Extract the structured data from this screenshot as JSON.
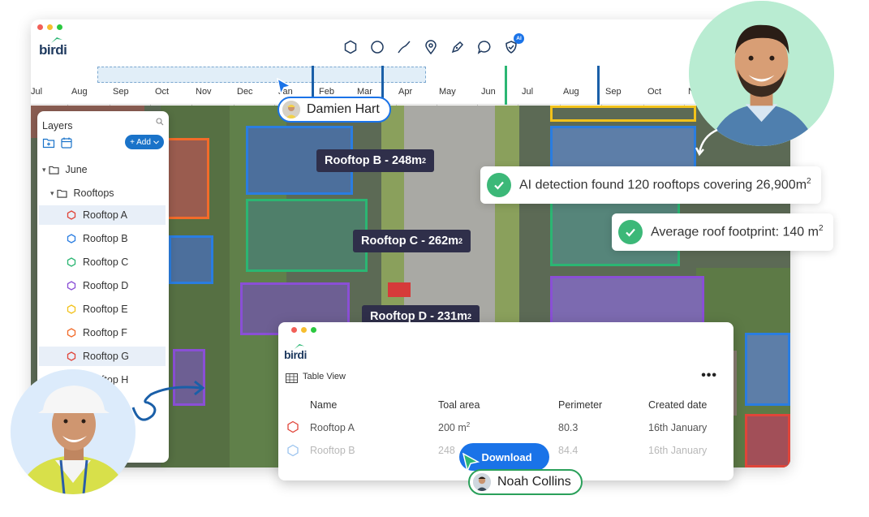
{
  "app": {
    "logo_text": "birdi",
    "tools": [
      "polygon-icon",
      "circle-icon",
      "line-icon",
      "pin-icon",
      "pen-icon",
      "comment-icon",
      "ai-shield-icon"
    ],
    "ai_badge": "AI"
  },
  "timeline": {
    "months": [
      "Jul",
      "Aug",
      "Sep",
      "Oct",
      "Nov",
      "Dec",
      "Jan",
      "Feb",
      "Mar",
      "Apr",
      "May",
      "Jun",
      "Jul",
      "Aug",
      "Sep",
      "Oct",
      "N"
    ]
  },
  "layers": {
    "title": "Layers",
    "add_label": "+ Add",
    "tree": [
      {
        "label": "June",
        "color": ""
      },
      {
        "label": "Rooftops",
        "color": ""
      },
      {
        "label": "Rooftop A",
        "color": "#e0453a"
      },
      {
        "label": "Rooftop B",
        "color": "#2a7de1"
      },
      {
        "label": "Rooftop C",
        "color": "#2bb673"
      },
      {
        "label": "Rooftop D",
        "color": "#8a4fd6"
      },
      {
        "label": "Rooftop E",
        "color": "#f2c21b"
      },
      {
        "label": "Rooftop F",
        "color": "#f26b2a"
      },
      {
        "label": "Rooftop G",
        "color": "#e0453a"
      },
      {
        "label": "Rooftop H",
        "color": "#2a7de1"
      }
    ]
  },
  "map_labels": {
    "b_name": "Rooftop B - 248m",
    "c_name": "Rooftop C - 262m",
    "d_name": "Rooftop D - 231m",
    "sup": "2"
  },
  "users": {
    "damien": "Damien Hart",
    "noah": "Noah Collins"
  },
  "notices": {
    "ai_detection": "AI detection found 120 rooftops covering 26,900m",
    "footprint": "Average roof footprint: 140 m",
    "sup": "2"
  },
  "table": {
    "title": "Table View",
    "more": "•••",
    "columns": [
      "Name",
      "Toal area",
      "Perimeter",
      "Created date"
    ],
    "rows": [
      {
        "name": "Rooftop A",
        "area": "200 m",
        "perimeter": "80.3",
        "created": "16th January"
      },
      {
        "name": "Rooftop B",
        "area": "248",
        "perimeter": "84.4",
        "created": "16th January"
      }
    ],
    "download_label": "Download"
  },
  "colors": {
    "accent": "#1a73e8",
    "success": "#3cb878",
    "label_bg": "#2f2f4a"
  }
}
